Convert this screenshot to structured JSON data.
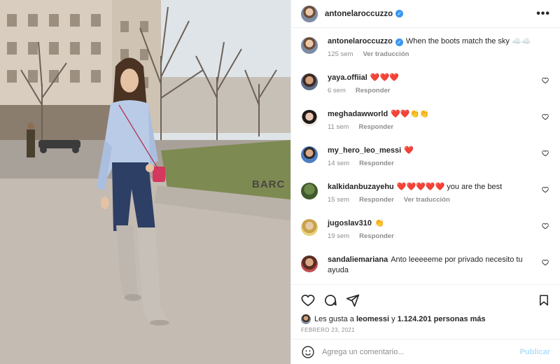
{
  "post": {
    "username": "antonelaroccuzzo",
    "caption": "When the boots match the sky",
    "caption_emoji": "☁️☁️",
    "caption_time": "125 sem",
    "caption_translate": "Ver traducción",
    "photo_sign_text": "BARC"
  },
  "header": {
    "username": "antonelaroccuzzo",
    "more_label": "•••"
  },
  "comments": [
    {
      "user": "yaya.offiial",
      "text": "❤️❤️❤️",
      "time": "6 sem",
      "reply": "Responder",
      "translate": ""
    },
    {
      "user": "meghadawworld",
      "text": "❤️❤️👏👏",
      "time": "11 sem",
      "reply": "Responder",
      "translate": ""
    },
    {
      "user": "my_hero_leo_messi",
      "text": "❤️",
      "time": "14 sem",
      "reply": "Responder",
      "translate": ""
    },
    {
      "user": "kalkidanbuzayehu",
      "text": "❤️❤️❤️❤️❤️ you are the best",
      "time": "15 sem",
      "reply": "Responder",
      "translate": "Ver traducción"
    },
    {
      "user": "jugoslav310",
      "text": "👏",
      "time": "19 sem",
      "reply": "Responder",
      "translate": ""
    },
    {
      "user": "sandaliemariana",
      "text": "Anto leeeeeme por privado necesito tu ayuda",
      "time": "",
      "reply": "",
      "translate": ""
    }
  ],
  "likes": {
    "prefix": "Les gusta a",
    "user": "leomessi",
    "middle": "y",
    "count": "1.124.201 personas más"
  },
  "date": "FEBRERO 23, 2021",
  "add_comment": {
    "placeholder": "Agrega un comentario...",
    "publish": "Publicar"
  },
  "colors": {
    "verified": "#3897f0",
    "heart": "#ed4956",
    "muted": "#8e8e8e",
    "publish": "#b2dffc"
  }
}
